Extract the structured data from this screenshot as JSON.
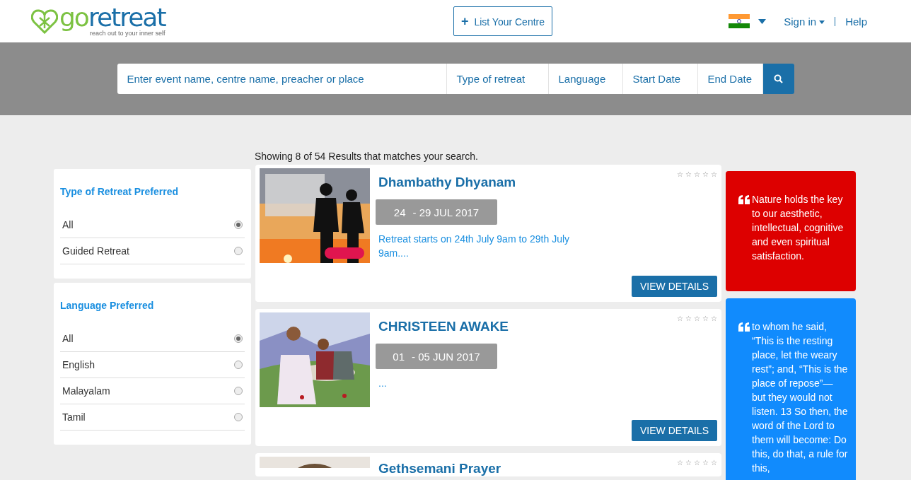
{
  "header": {
    "logo": {
      "brand_prefix": "go",
      "brand_suffix": "retreat",
      "tagline": "reach out to your inner self"
    },
    "list_button": {
      "icon": "+",
      "label": "List Your Centre"
    },
    "sign_in": "Sign in",
    "help": "Help"
  },
  "search": {
    "placeholder": "Enter event name, centre name, preacher or place",
    "filters": [
      "Type of retreat",
      "Language",
      "Start Date",
      "End Date"
    ]
  },
  "results_summary": "Showing 8 of 54 Results that matches your search.",
  "filters": [
    {
      "title": "Type of Retreat Preferred",
      "options": [
        {
          "label": "All",
          "selected": true
        },
        {
          "label": "Guided Retreat",
          "selected": false
        }
      ]
    },
    {
      "title": "Language Preferred",
      "options": [
        {
          "label": "All",
          "selected": true
        },
        {
          "label": "English",
          "selected": false
        },
        {
          "label": "Malayalam",
          "selected": false
        },
        {
          "label": "Tamil",
          "selected": false
        }
      ]
    }
  ],
  "results": [
    {
      "title": "Dhambathy Dhyanam",
      "date_start": "24",
      "date_end": "- 29 JUL 2017",
      "description": "Retreat starts on 24th July 9am to 29th July 9am....",
      "stars": 0,
      "button": "VIEW DETAILS"
    },
    {
      "title": "CHRISTEEN AWAKE",
      "date_start": "01",
      "date_end": "- 05 JUN 2017",
      "description": "...",
      "stars": 0,
      "button": "VIEW DETAILS"
    },
    {
      "title": "Gethsemani Prayer",
      "stars": 0
    }
  ],
  "quotes": [
    {
      "text": "Nature holds the key to our aesthetic, intellectual, cognitive and even spiritual satisfaction.",
      "color": "#dd0000"
    },
    {
      "text": "to whom he said, “This is the resting place, let the weary rest”; and, “This is the place of repose”— but they would not listen. 13 So then, the word of the Lord to them will become: Do this, do that, a rule for this,",
      "color": "#118bfd"
    }
  ]
}
